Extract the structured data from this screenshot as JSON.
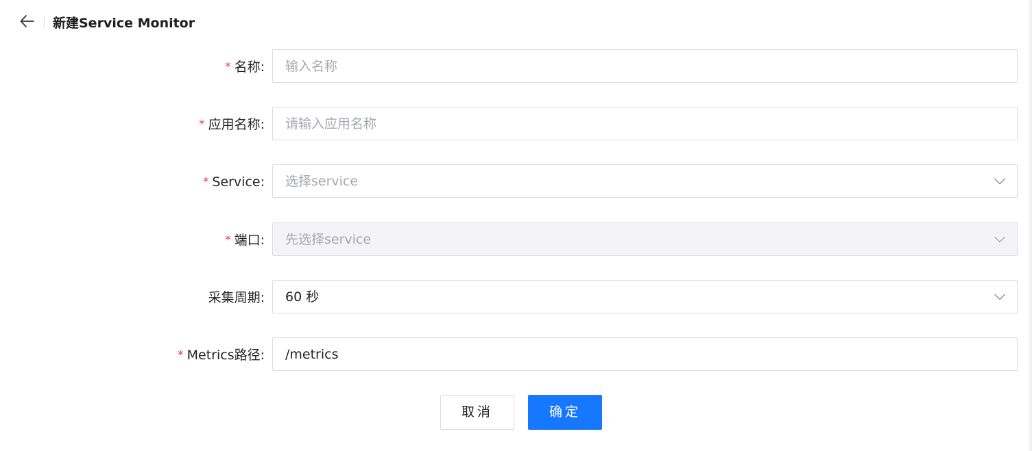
{
  "header": {
    "title": "新建Service Monitor",
    "back_icon": "arrow-left-icon"
  },
  "form": {
    "fields": [
      {
        "label": "名称:",
        "required": true,
        "type": "input",
        "value": "",
        "placeholder": "输入名称"
      },
      {
        "label": "应用名称:",
        "required": true,
        "type": "input",
        "value": "",
        "placeholder": "请输入应用名称"
      },
      {
        "label": "Service:",
        "required": true,
        "type": "select",
        "value": "",
        "placeholder": "选择service"
      },
      {
        "label": "端口:",
        "required": true,
        "type": "select",
        "disabled": true,
        "value": "",
        "placeholder": "先选择service"
      },
      {
        "label": "采集周期:",
        "required": false,
        "type": "select",
        "value": "60 秒",
        "placeholder": ""
      },
      {
        "label": "Metrics路径:",
        "required": true,
        "type": "input",
        "value": "/metrics",
        "placeholder": ""
      }
    ],
    "required_mark": "*"
  },
  "actions": {
    "cancel_label": "取消",
    "confirm_label": "确定"
  },
  "colors": {
    "primary": "#1677ff",
    "required": "#e2384e",
    "disabled_bg": "#f4f4f8",
    "border": "#d9dbe0",
    "placeholder": "#a6a8b0"
  }
}
